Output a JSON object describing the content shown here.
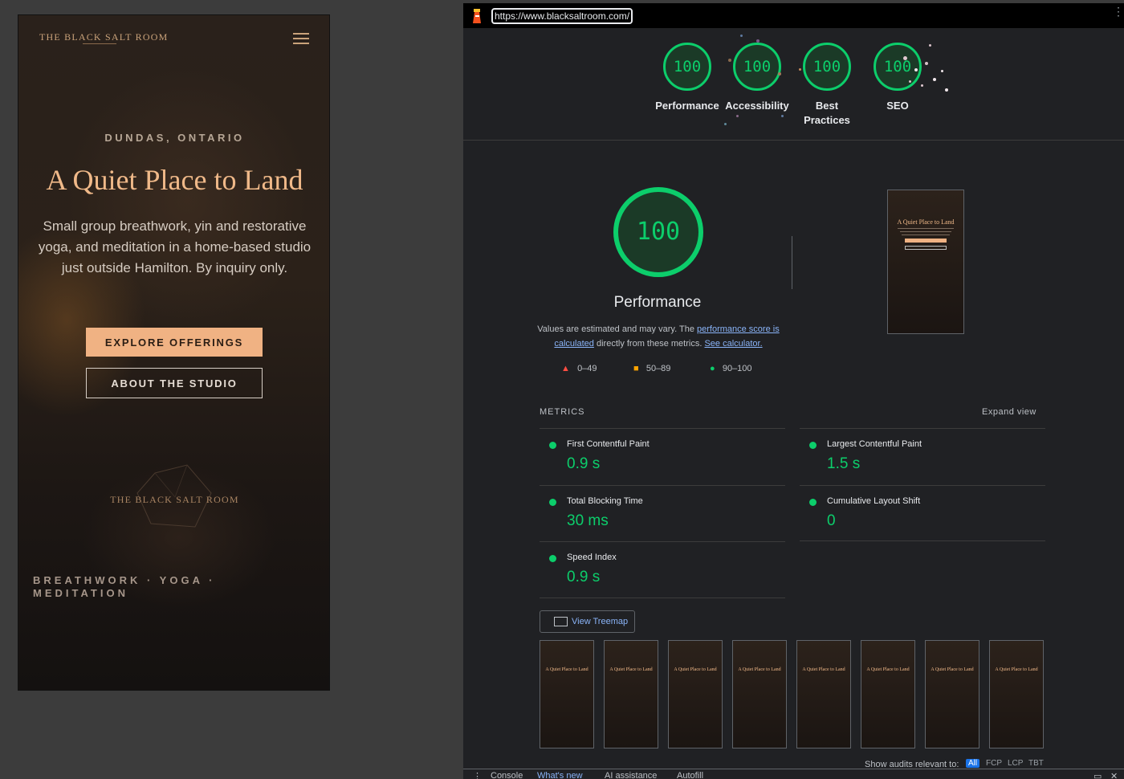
{
  "site": {
    "brand": "THE BLACK SALT ROOM",
    "location": "DUNDAS, ONTARIO",
    "title": "A Quiet Place to Land",
    "description": "Small group breathwork, yin and restorative yoga, and meditation in a home-based studio just outside Hamilton. By inquiry only.",
    "primary_button": "EXPLORE OFFERINGS",
    "secondary_button": "ABOUT THE STUDIO",
    "logo_text": "THE BLACK SALT ROOM",
    "tagline": "BREATHWORK · YOGA · MEDITATION"
  },
  "report": {
    "url": "https://www.blacksaltroom.com/",
    "gauges": [
      {
        "score": "100",
        "label": "Performance"
      },
      {
        "score": "100",
        "label": "Accessibility"
      },
      {
        "score": "100",
        "label": "Best Practices"
      },
      {
        "score": "100",
        "label": "SEO"
      }
    ],
    "main_score": "100",
    "main_title": "Performance",
    "desc_prefix": "Values are estimated and may vary. The ",
    "desc_link": "performance score is calculated",
    "desc_middle": " directly from these metrics.",
    "desc_link2": "See calculator.",
    "legend": [
      {
        "range": "0–49",
        "color": "#ff4e42"
      },
      {
        "range": "50–89",
        "color": "#ffa400"
      },
      {
        "range": "90–100",
        "color": "#0cce6b"
      }
    ],
    "metrics_heading": "METRICS",
    "expand_label": "Expand view",
    "metrics": [
      {
        "name": "First Contentful Paint",
        "value": "0.9 s"
      },
      {
        "name": "Largest Contentful Paint",
        "value": "1.5 s"
      },
      {
        "name": "Total Blocking Time",
        "value": "30 ms"
      },
      {
        "name": "Cumulative Layout Shift",
        "value": "0"
      },
      {
        "name": "Speed Index",
        "value": "0.9 s"
      }
    ],
    "treemap_label": "View Treemap",
    "audits_label": "Show audits relevant to:",
    "filters": [
      "All",
      "FCP",
      "LCP",
      "TBT"
    ],
    "drawer_tabs": [
      "Console",
      "What's new",
      "AI assistance",
      "Autofill"
    ],
    "colors": {
      "pass": "#0cce6b",
      "link": "#8ab4f8",
      "accent": "#f0b283"
    }
  }
}
